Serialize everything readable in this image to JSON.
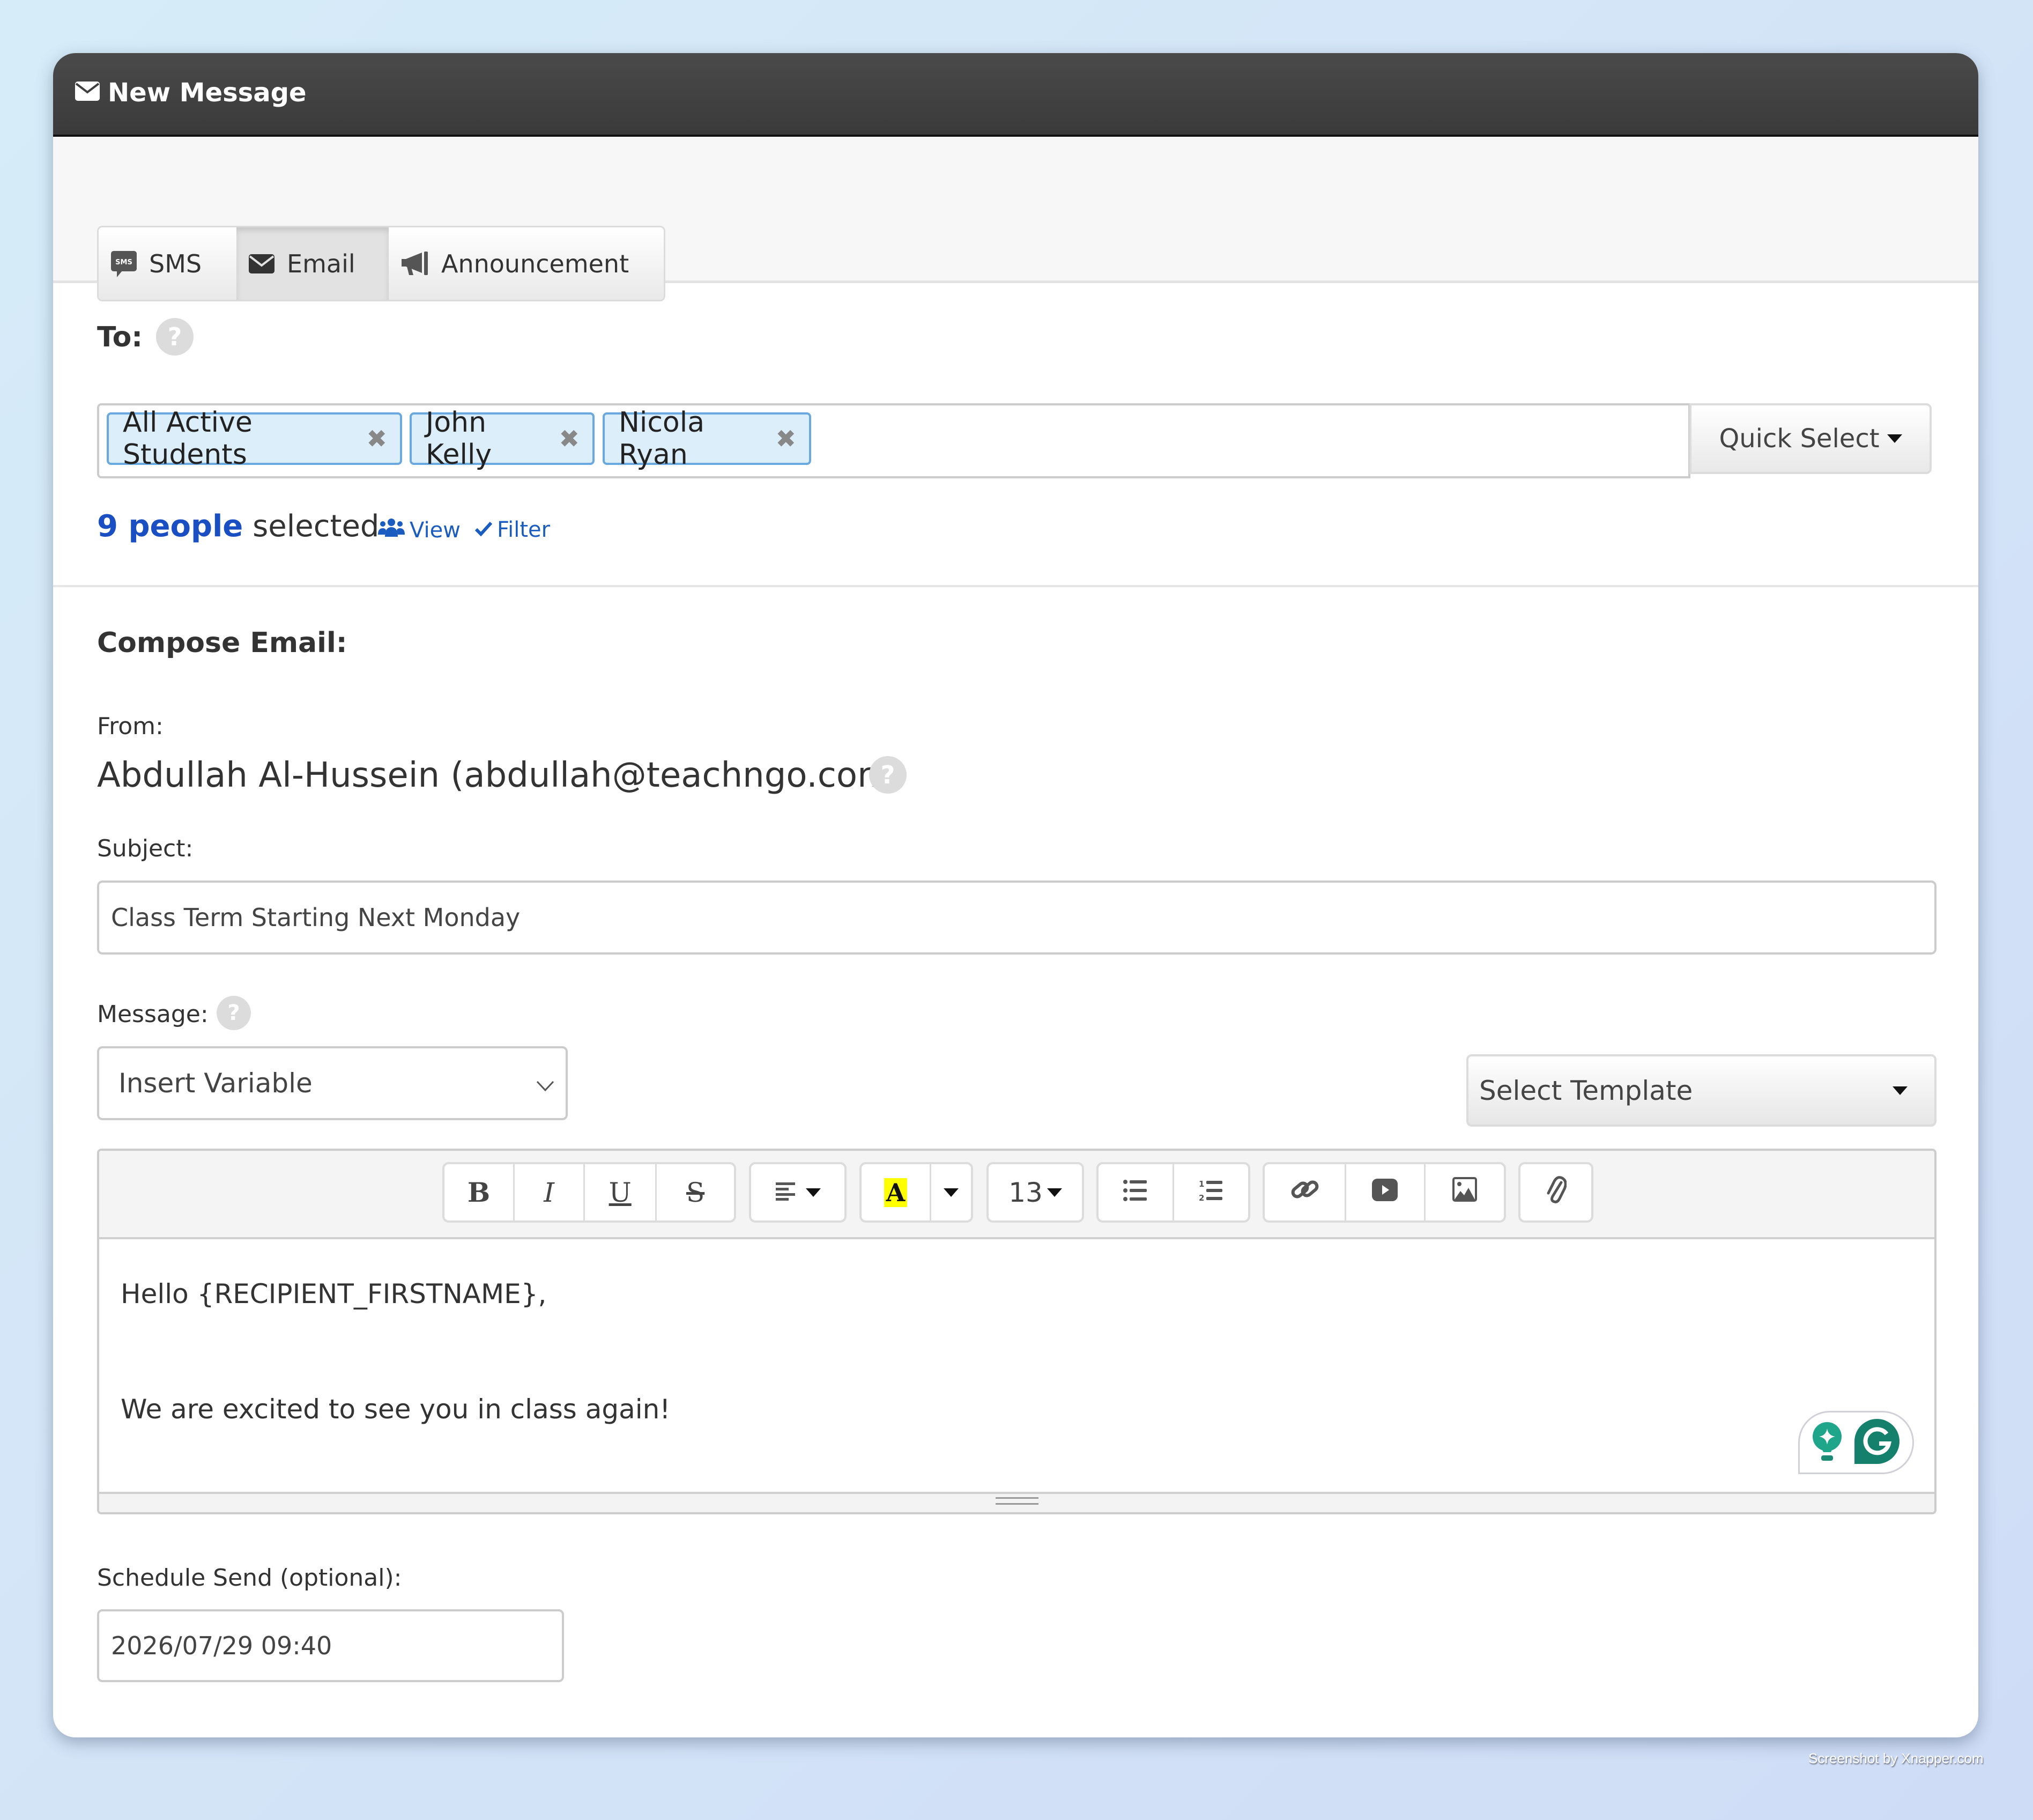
{
  "window": {
    "title": "New Message",
    "title_icon": "envelope-icon"
  },
  "tabs": [
    {
      "label": "SMS",
      "icon": "sms-icon",
      "active": false
    },
    {
      "label": "Email",
      "icon": "envelope-icon",
      "active": true
    },
    {
      "label": "Announcement",
      "icon": "bullhorn-icon",
      "active": false
    }
  ],
  "recipients": {
    "label": "To:",
    "help": "?",
    "chips": [
      {
        "label": "All Active Students",
        "remove": "✖"
      },
      {
        "label": "John Kelly",
        "remove": "✖"
      },
      {
        "label": "Nicola Ryan",
        "remove": "✖"
      }
    ],
    "quick_select_label": "Quick Select",
    "count_bold": "9 people",
    "count_suffix": " selected",
    "view_label": "View",
    "filter_label": "Filter"
  },
  "compose": {
    "heading": "Compose Email:",
    "from_label": "From:",
    "from_value": "Abdullah Al-Hussein (abdullah@teachngo.com)",
    "help": "?",
    "subject_label": "Subject:",
    "subject_value": "Class Term Starting Next Monday",
    "message_label": "Message:",
    "insert_variable_label": "Insert Variable",
    "select_template_label": "Select Template"
  },
  "editor": {
    "toolbar": {
      "bold": "B",
      "italic": "I",
      "underline": "U",
      "strikethrough": "S",
      "font_size": "13",
      "highlight_letter": "A",
      "highlight_color": "#ffff00"
    },
    "body_lines": [
      "Hello {RECIPIENT_FIRSTNAME},",
      "We are excited to see you in class again!"
    ],
    "grammarly_color": "#15806b"
  },
  "schedule": {
    "label": "Schedule Send (optional):",
    "value": "2026/07/29 09:40"
  },
  "colors": {
    "accent": "#1a4fc4",
    "chip_bg": "#ddeefb",
    "chip_border": "#6aa8e0",
    "header_bg": "#3f3f3f"
  },
  "watermark": "Screenshot by Xnapper.com"
}
